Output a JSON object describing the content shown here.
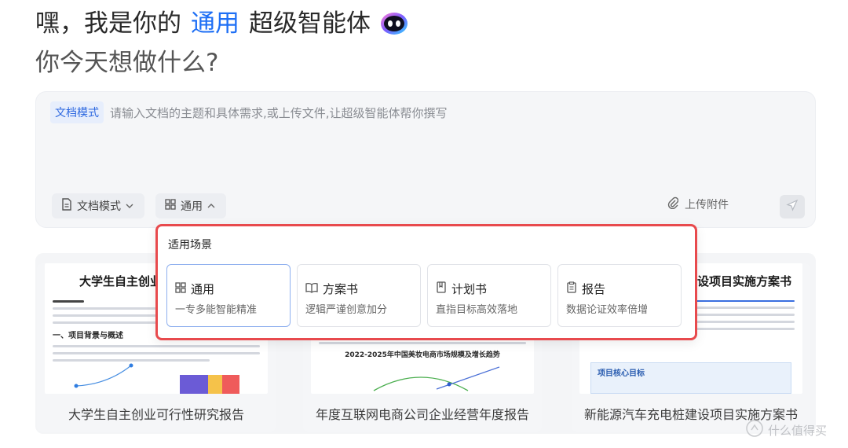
{
  "hero": {
    "greeting_prefix": "嘿，我是你的",
    "greeting_accent": "通用",
    "greeting_suffix": "超级智能体",
    "subtitle": "你今天想做什么?"
  },
  "composer": {
    "mode_chip": "文档模式",
    "placeholder": "请输入文档的主题和具体需求,或上传文件,让超级智能体帮你撰写",
    "mode_button": "文档模式",
    "scene_button": "通用",
    "upload_label": "上传附件"
  },
  "dropdown": {
    "title": "适用场景",
    "options": [
      {
        "label": "通用",
        "desc": "一专多能智能精准"
      },
      {
        "label": "方案书",
        "desc": "逻辑严谨创意加分"
      },
      {
        "label": "计划书",
        "desc": "直指目标高效落地"
      },
      {
        "label": "报告",
        "desc": "数据论证效率倍增"
      }
    ]
  },
  "templates": [
    {
      "doc_title": "大学生自主创业",
      "section": "一、项目背景与概述",
      "label": "大学生自主创业可行性研究报告"
    },
    {
      "doc_title": "",
      "section": "2022-2025年中国美妆电商市场规模及增长趋势",
      "label": "年度互联网电商公司企业经营年度报告"
    },
    {
      "doc_title": "设项目实施方案书",
      "section": "项目核心目标",
      "label": "新能源汽车充电桩建设项目实施方案书"
    }
  ],
  "watermark": "什么值得买",
  "colors": {
    "accent": "#1e6ff5",
    "highlight_border": "#e84a4d"
  }
}
